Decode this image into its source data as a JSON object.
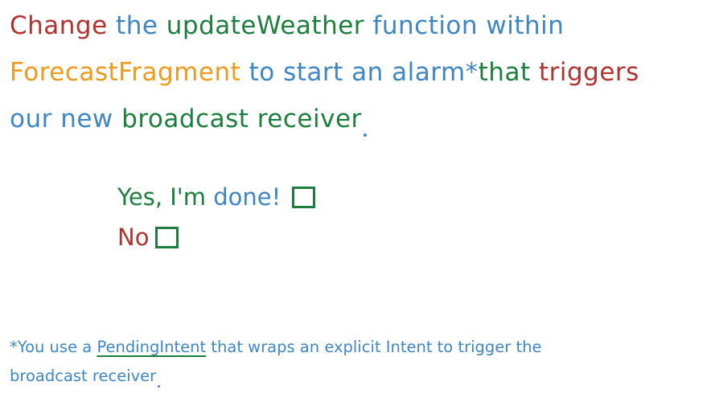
{
  "instruction": {
    "line1": {
      "w1": "Change",
      "w2": "the",
      "w3": "updateWeather",
      "w4": "function within"
    },
    "line2": {
      "w1": "ForecastFragment",
      "w2": "to start an alarm*",
      "w3": "that",
      "w4": "triggers"
    },
    "line3": {
      "w1": "our new",
      "w2": "broadcast receiver"
    }
  },
  "options": {
    "yes": {
      "prefix": "Yes, I'm",
      "done": "done!"
    },
    "no": {
      "label": "No"
    }
  },
  "footnote": {
    "prefix": "*You use a",
    "link": "PendingIntent",
    "suffix": "that wraps an explicit Intent to trigger the",
    "line2": "broadcast receiver"
  },
  "colors": {
    "red": "#b2332d",
    "blue": "#3f86c4",
    "green": "#1d7f3e",
    "orange": "#f09a1c"
  }
}
